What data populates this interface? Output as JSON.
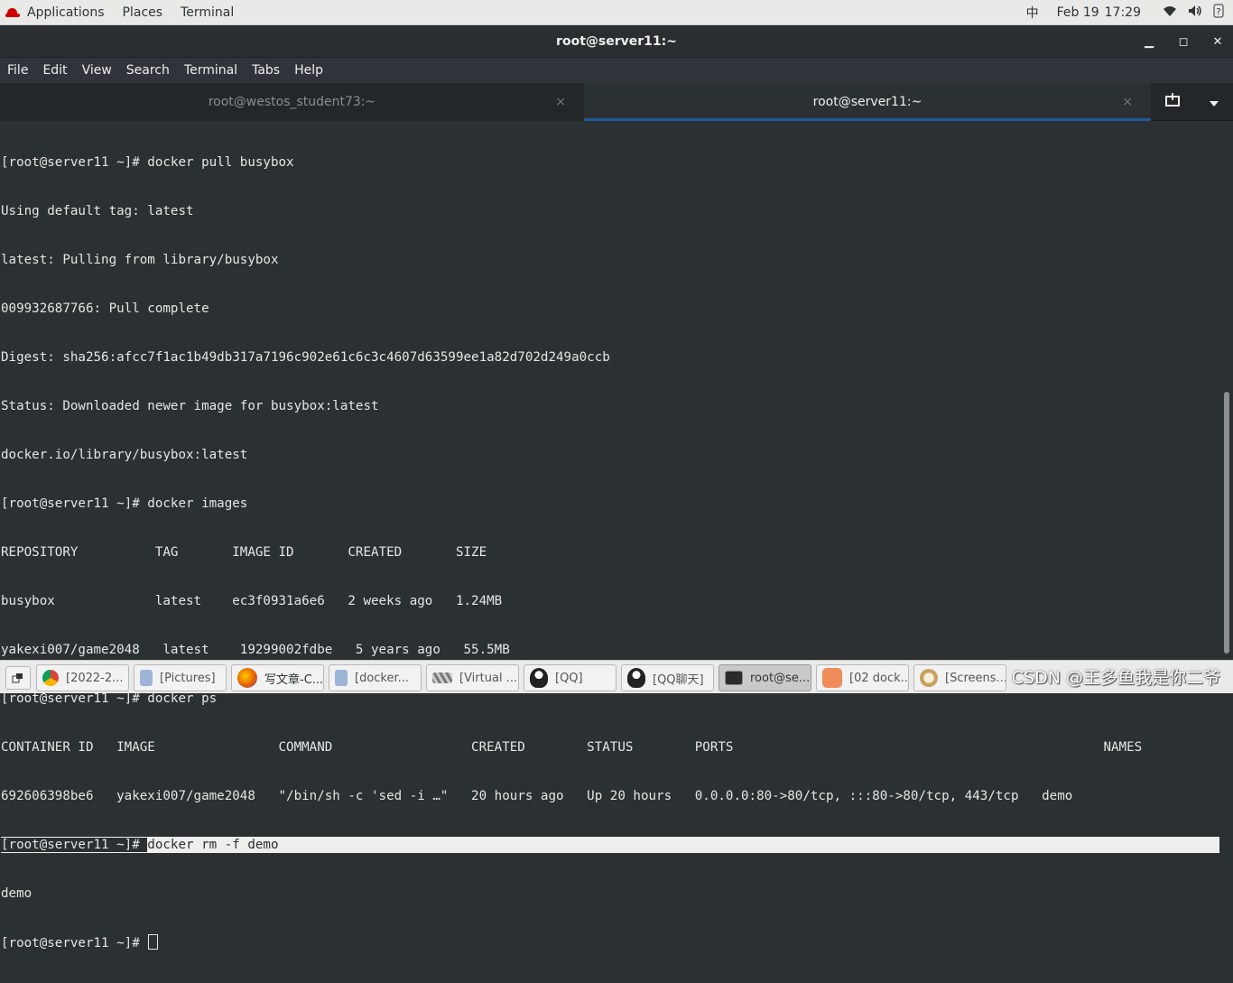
{
  "top_panel": {
    "applications": "Applications",
    "places": "Places",
    "terminal": "Terminal",
    "input_method": "中",
    "date": "Feb 19",
    "time": "17:29",
    "icons": [
      "wifi-icon",
      "volume-icon",
      "help-icon"
    ]
  },
  "window": {
    "title": "root@server11:~",
    "minimize": "▁",
    "maximize": "◻",
    "close": "✕"
  },
  "menubar": {
    "items": [
      "File",
      "Edit",
      "View",
      "Search",
      "Terminal",
      "Tabs",
      "Help"
    ]
  },
  "tabs": [
    {
      "label": "root@westos_student73:~",
      "close": "×"
    },
    {
      "label": "root@server11:~",
      "close": "×"
    }
  ],
  "terminal": {
    "lines": [
      "[root@server11 ~]# docker pull busybox",
      "Using default tag: latest",
      "latest: Pulling from library/busybox",
      "009932687766: Pull complete",
      "Digest: sha256:afcc7f1ac1b49db317a7196c902e61c6c3c4607d63599ee1a82d702d249a0ccb",
      "Status: Downloaded newer image for busybox:latest",
      "docker.io/library/busybox:latest",
      "[root@server11 ~]# docker images",
      "REPOSITORY          TAG       IMAGE ID       CREATED       SIZE",
      "busybox             latest    ec3f0931a6e6   2 weeks ago   1.24MB",
      "yakexi007/game2048   latest    19299002fdbe   5 years ago   55.5MB",
      "[root@server11 ~]# docker ps",
      "CONTAINER ID   IMAGE                COMMAND                  CREATED        STATUS        PORTS                                                NAMES",
      "692606398be6   yakexi007/game2048   \"/bin/sh -c 'sed -i …\"   20 hours ago   Up 20 hours   0.0.0.0:80->80/tcp, :::80->80/tcp, 443/tcp   demo"
    ],
    "highlight_prompt": "[root@server11 ~]# ",
    "highlight_command": "docker rm -f demo",
    "output_after": "demo",
    "final_prompt": "[root@server11 ~]# "
  },
  "taskbar": {
    "items": [
      {
        "label": "[2022-2...",
        "icon": "chrome-icon",
        "color": "#4285f4"
      },
      {
        "label": "[Pictures]",
        "icon": "file-manager-icon",
        "color": "#9db4d6"
      },
      {
        "label": "写文章-C...",
        "icon": "firefox-icon",
        "color": "#e66000"
      },
      {
        "label": "[docker...",
        "icon": "document-icon",
        "color": "#9db4d6"
      },
      {
        "label": "[Virtual ...",
        "icon": "virt-manager-icon",
        "color": "#888888"
      },
      {
        "label": "[QQ]",
        "icon": "qq-penguin-icon",
        "color": "#222222"
      },
      {
        "label": "[QQ聊天]",
        "icon": "qq-penguin-icon",
        "color": "#222222"
      },
      {
        "label": "root@se...",
        "icon": "terminal-icon",
        "color": "#2b2b2b"
      },
      {
        "label": "[02 dock...",
        "icon": "presentation-icon",
        "color": "#f08c5a"
      },
      {
        "label": "[Screens...",
        "icon": "screenshot-icon",
        "color": "#c8a060"
      }
    ],
    "watermark": "CSDN @王多鱼我是你二爷"
  }
}
